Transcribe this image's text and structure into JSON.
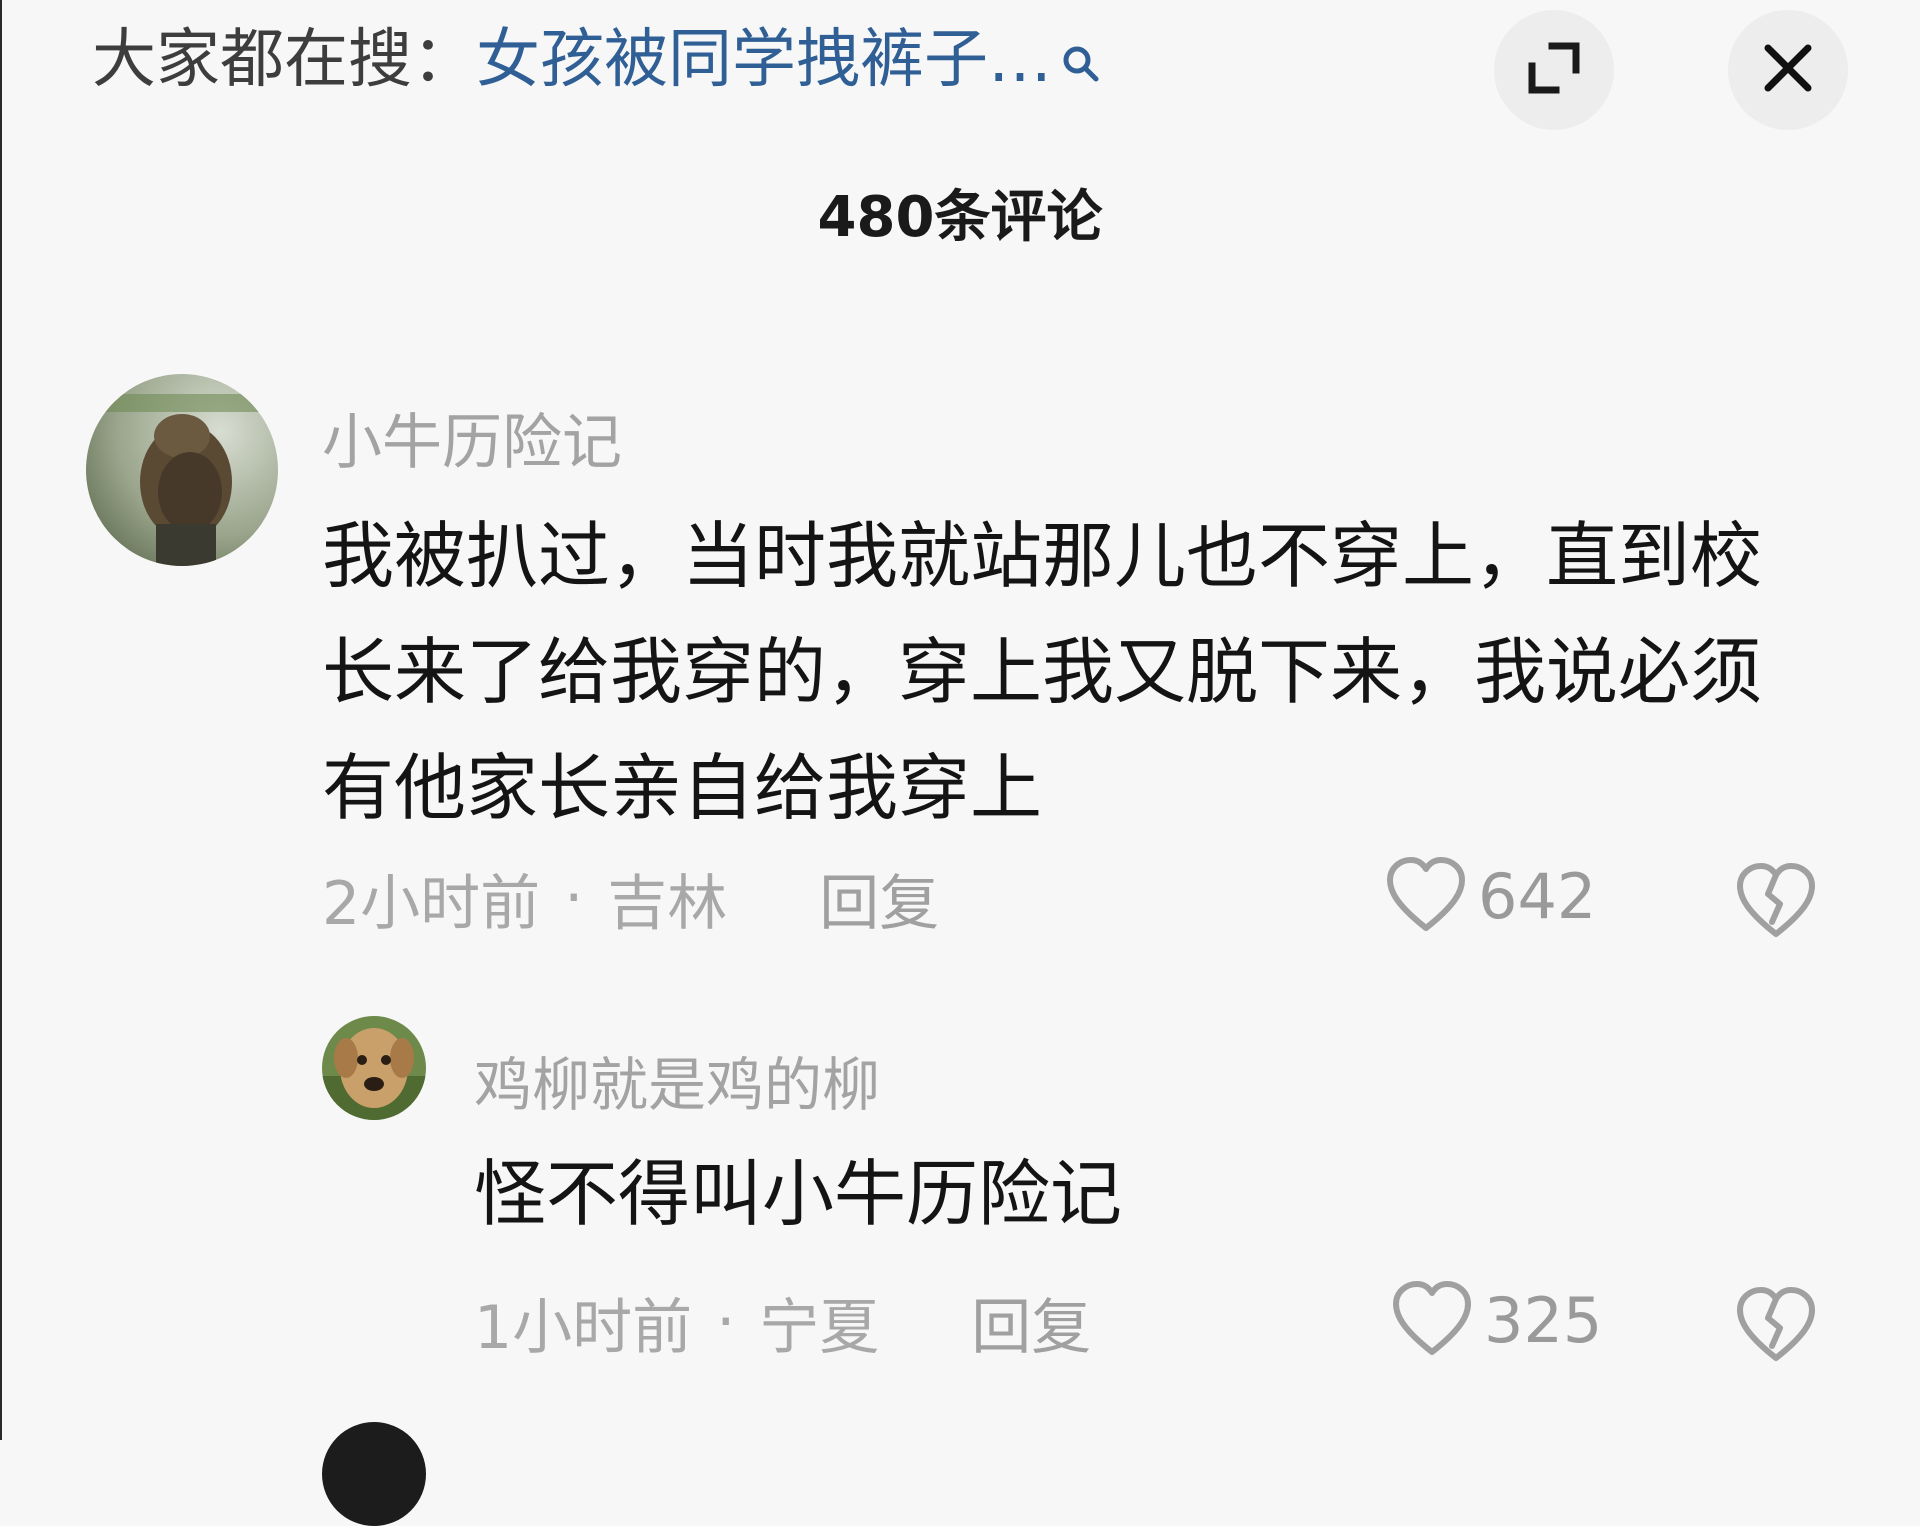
{
  "search_hint": {
    "prefix": "大家都在搜：",
    "query": "女孩被同学拽裤子…",
    "icon": "search-icon"
  },
  "controls": {
    "expand_icon": "expand-icon",
    "close_icon": "close-icon"
  },
  "comment_count": "480条评论",
  "comments": [
    {
      "username": "小牛历险记",
      "text": "我被扒过，当时我就站那儿也不穿上，直到校长来了给我穿的，穿上我又脱下来，我说必须有他家长亲自给我穿上",
      "time": "2小时前",
      "separator": "·",
      "location": "吉林",
      "reply_label": "回复",
      "likes": "642",
      "like_icon": "heart-icon",
      "dislike_icon": "broken-heart-icon"
    },
    {
      "username": "鸡柳就是鸡的柳",
      "text": "怪不得叫小牛历险记",
      "time": "1小时前",
      "separator": "·",
      "location": "宁夏",
      "reply_label": "回复",
      "likes": "325",
      "like_icon": "heart-icon",
      "dislike_icon": "broken-heart-icon"
    }
  ],
  "colors": {
    "background": "#f7f7f7",
    "search_query": "#2f5f95",
    "muted_text": "#a3a3a3",
    "body_text": "#141414"
  }
}
